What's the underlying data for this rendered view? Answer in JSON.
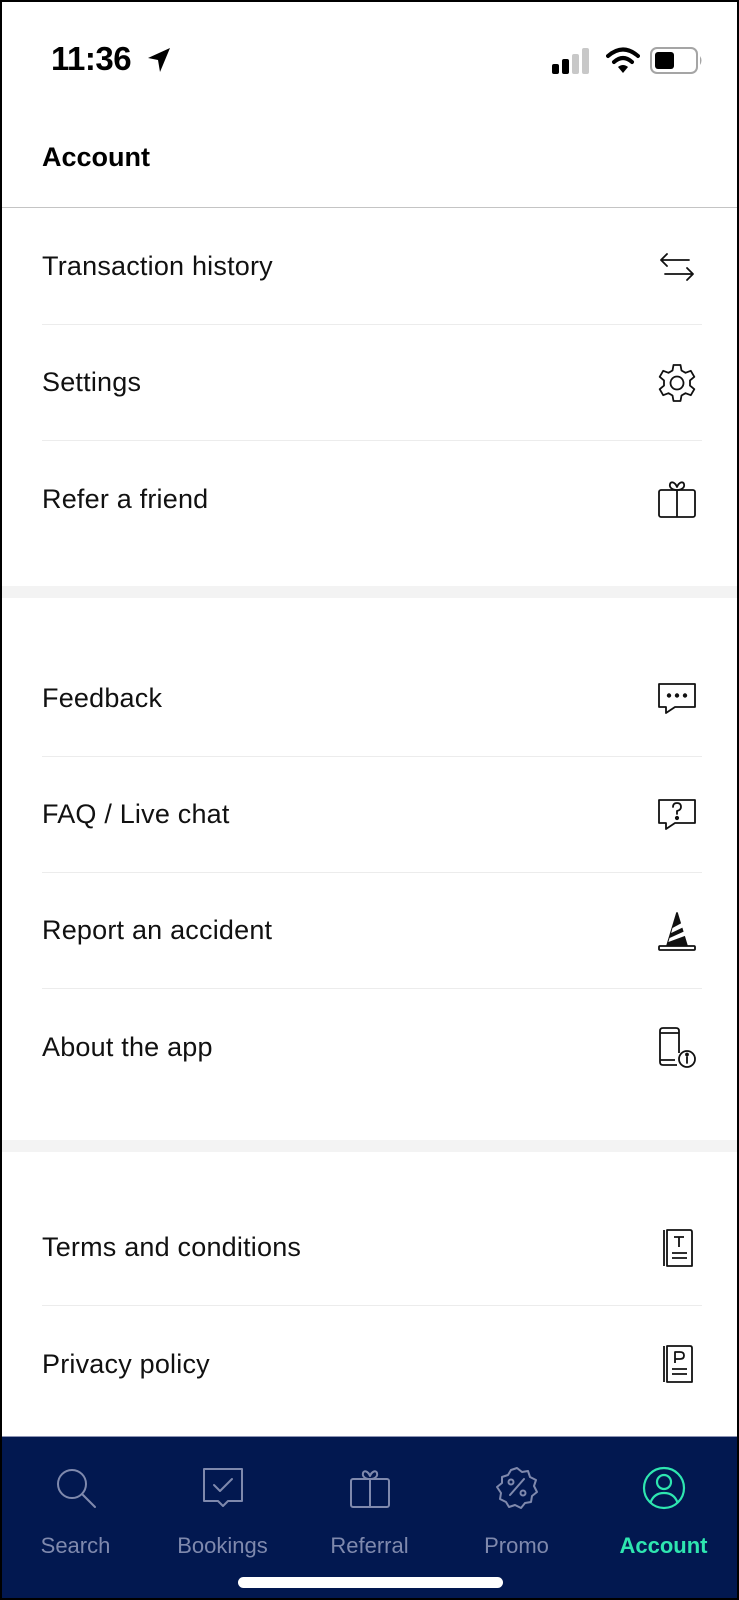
{
  "status_bar": {
    "time": "11:36",
    "location_icon": "location-arrow-icon",
    "signal_bars": 2,
    "signal_bars_total": 4,
    "wifi_icon": "wifi-icon",
    "battery_level": 0.45
  },
  "header": {
    "title": "Account"
  },
  "sections": [
    {
      "items": [
        {
          "label": "Transaction history",
          "icon": "transfer-arrows-icon"
        },
        {
          "label": "Settings",
          "icon": "gear-icon"
        },
        {
          "label": "Refer a friend",
          "icon": "gift-icon"
        }
      ]
    },
    {
      "items": [
        {
          "label": "Feedback",
          "icon": "chat-bubble-dots-icon"
        },
        {
          "label": "FAQ / Live chat",
          "icon": "chat-bubble-question-icon"
        },
        {
          "label": "Report an accident",
          "icon": "traffic-cone-icon"
        },
        {
          "label": "About the app",
          "icon": "phone-info-icon"
        }
      ]
    },
    {
      "items": [
        {
          "label": "Terms and conditions",
          "icon": "document-t-icon"
        },
        {
          "label": "Privacy policy",
          "icon": "document-p-icon"
        }
      ]
    }
  ],
  "bottom_nav": {
    "items": [
      {
        "label": "Search",
        "icon": "search-icon",
        "active": false
      },
      {
        "label": "Bookings",
        "icon": "bookings-check-icon",
        "active": false
      },
      {
        "label": "Referral",
        "icon": "gift-icon",
        "active": false
      },
      {
        "label": "Promo",
        "icon": "promo-percent-badge-icon",
        "active": false
      },
      {
        "label": "Account",
        "icon": "user-circle-icon",
        "active": true
      }
    ],
    "background_color": "#021850",
    "inactive_color": "#7f89ad",
    "active_color": "#2ee6b0"
  }
}
